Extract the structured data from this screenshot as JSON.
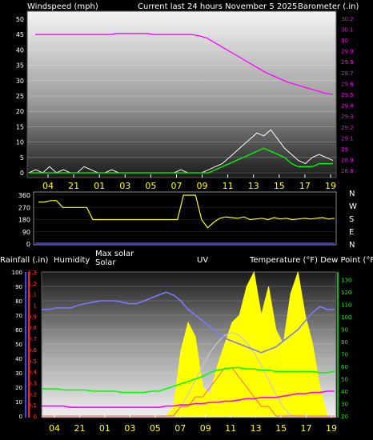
{
  "header": {
    "windspeed_label": "Windspeed (mph)",
    "title": "Current last 24 hours November 5 2025",
    "barometer_label": "Barometer (.in)"
  },
  "panel2": {
    "compass": [
      "N",
      "W",
      "S",
      "E",
      "N"
    ]
  },
  "panel3": {
    "rainfall_label": "Rainfall (.in)",
    "humidity_label": "Humidity",
    "maxsolar_label": "Max solar",
    "solar_label": "Solar",
    "uv_label": "UV",
    "temperature_label": "Temperature (°F) Dew Point (°F)"
  },
  "colors": {
    "windspeed": "#ffffff",
    "gust": "#00ff00",
    "barometer": "#ff00ff",
    "direction": "#ffff00",
    "humidity": "#7a7aff",
    "temperature": "#00ff00",
    "dewpoint": "#ff00ff",
    "solar": "#ffff00",
    "maxsolar": "#c8c8c8",
    "uv": "#ff6060",
    "rainfall": "#5050ff"
  },
  "chart_data": [
    {
      "type": "line",
      "x_ticks": [
        "04",
        "21",
        "01",
        "03",
        "05",
        "07",
        "09",
        "11",
        "13",
        "15",
        "17",
        "19"
      ],
      "y_left": {
        "label": "Windspeed (mph)",
        "ticks": [
          0,
          5,
          10,
          15,
          20,
          25,
          30,
          35,
          40,
          45,
          50
        ],
        "ylim": [
          0,
          50
        ]
      },
      "y_right": {
        "label": "Barometer (.in)",
        "ticks": [
          28.8,
          28.9,
          29.0,
          29.1,
          29.2,
          29.3,
          29.4,
          29.5,
          29.6,
          29.7,
          29.8,
          29.9,
          30.0,
          30.1,
          30.2
        ],
        "ylim": [
          28.75,
          30.25
        ]
      },
      "series": [
        {
          "values": [
            0,
            1,
            0,
            2,
            0,
            1,
            0,
            0,
            2,
            1,
            0,
            0,
            1,
            0,
            0,
            0,
            0,
            0,
            0,
            0,
            0,
            0,
            1,
            0,
            0,
            0,
            1,
            2,
            3,
            5,
            7,
            9,
            11,
            13,
            12,
            14,
            11,
            8,
            6,
            4,
            3,
            5,
            6,
            5,
            4
          ]
        },
        {
          "values": [
            0,
            0,
            0,
            0,
            0,
            0,
            0,
            0,
            0,
            0,
            0,
            0,
            0,
            0,
            0,
            0,
            0,
            0,
            0,
            0,
            0,
            0,
            0,
            0,
            0,
            0,
            0,
            1,
            2,
            3,
            4,
            5,
            6,
            7,
            8,
            7,
            6,
            5,
            3,
            2,
            2,
            2,
            3,
            3,
            3
          ]
        },
        {
          "values": [
            30.05,
            30.05,
            30.05,
            30.05,
            30.05,
            30.05,
            30.05,
            30.05,
            30.05,
            30.05,
            30.05,
            30.06,
            30.06,
            30.06,
            30.06,
            30.06,
            30.05,
            30.05,
            30.05,
            30.05,
            30.05,
            30.05,
            30.04,
            30.02,
            29.98,
            29.94,
            29.9,
            29.86,
            29.82,
            29.78,
            29.74,
            29.7,
            29.67,
            29.64,
            29.61,
            29.59,
            29.57,
            29.55,
            29.53,
            29.51,
            29.5
          ]
        }
      ]
    },
    {
      "type": "line",
      "y": {
        "ticks": [
          0,
          90,
          180,
          270,
          360
        ],
        "ylim": [
          0,
          360
        ]
      },
      "series": [
        {
          "values": [
            310,
            310,
            320,
            320,
            270,
            270,
            270,
            270,
            270,
            180,
            180,
            180,
            180,
            180,
            180,
            180,
            180,
            180,
            180,
            180,
            180,
            180,
            180,
            180,
            360,
            360,
            360,
            180,
            120,
            160,
            190,
            200,
            195,
            190,
            200,
            180,
            185,
            190,
            180,
            195,
            185,
            190,
            180,
            185,
            190,
            185,
            190,
            195,
            185,
            190
          ]
        }
      ]
    },
    {
      "type": "area",
      "x_ticks": [
        "04",
        "21",
        "01",
        "03",
        "05",
        "07",
        "09",
        "11",
        "13",
        "15",
        "17",
        "19"
      ],
      "y_left": {
        "label": "Humidity",
        "ticks": [
          0,
          10,
          20,
          30,
          40,
          50,
          60,
          70,
          80,
          90,
          100
        ],
        "ylim": [
          0,
          100
        ]
      },
      "y_rainfall": {
        "label": "Rainfall (.in)",
        "ticks": [
          0,
          0.1,
          0.2,
          0.3,
          0.4,
          0.5,
          0.6,
          0.7,
          0.8,
          0.9,
          1,
          1.1,
          1.2,
          1.3
        ],
        "ylim": [
          0,
          1.3
        ]
      },
      "y_right": {
        "label": "Temperature (°F) Dew Point (°F)",
        "ticks": [
          20,
          30,
          40,
          50,
          60,
          70,
          80,
          90,
          100,
          110,
          120,
          130
        ],
        "ylim": [
          20,
          135
        ]
      },
      "series": [
        {
          "values": [
            74,
            74,
            75,
            75,
            75,
            77,
            78,
            79,
            80,
            80,
            80,
            79,
            78,
            78,
            80,
            82,
            84,
            86,
            84,
            80,
            74,
            70,
            66,
            62,
            58,
            54,
            52,
            50,
            48,
            46,
            44,
            46,
            48,
            52,
            56,
            60,
            66,
            72,
            76,
            74,
            74
          ]
        },
        {
          "values": [
            42,
            42,
            42,
            41,
            41,
            41,
            41,
            40,
            40,
            40,
            40,
            39,
            39,
            39,
            39,
            40,
            40,
            42,
            44,
            46,
            48,
            50,
            52,
            55,
            57,
            58,
            59,
            59,
            58,
            58,
            57,
            57,
            56,
            56,
            56,
            56,
            56,
            56,
            55,
            55,
            56
          ]
        },
        {
          "values": [
            28,
            28,
            28,
            28,
            27,
            27,
            27,
            27,
            27,
            27,
            27,
            27,
            27,
            27,
            27,
            27,
            27,
            28,
            28,
            29,
            29,
            30,
            30,
            31,
            31,
            32,
            32,
            33,
            34,
            34,
            35,
            35,
            35,
            36,
            37,
            38,
            38,
            39,
            39,
            40,
            40
          ]
        },
        {
          "values": [
            0,
            0,
            0,
            0,
            0,
            0,
            0,
            0,
            0,
            0,
            0,
            0,
            0,
            0,
            0,
            0,
            0,
            0,
            60,
            450,
            650,
            550,
            200,
            150,
            350,
            500,
            650,
            700,
            900,
            1000,
            700,
            900,
            600,
            500,
            850,
            1000,
            700,
            500,
            200,
            0,
            0
          ]
        },
        {
          "values": [
            0,
            0,
            0,
            0,
            0,
            0,
            0,
            0,
            0,
            0,
            0,
            0,
            0,
            0,
            0,
            0,
            0,
            0,
            5,
            60,
            150,
            250,
            350,
            440,
            510,
            560,
            580,
            560,
            510,
            440,
            350,
            250,
            150,
            60,
            5,
            0,
            0,
            0,
            0,
            0,
            0
          ]
        },
        {
          "values": [
            0,
            0,
            0,
            0,
            0,
            0,
            0,
            0,
            0,
            0,
            0,
            0,
            0,
            0,
            0,
            0,
            0,
            0,
            0,
            1,
            1,
            2,
            2,
            3,
            4,
            5,
            5,
            4,
            3,
            2,
            1,
            1,
            0,
            0,
            0,
            0,
            0,
            0,
            0,
            0,
            0
          ]
        }
      ]
    }
  ]
}
